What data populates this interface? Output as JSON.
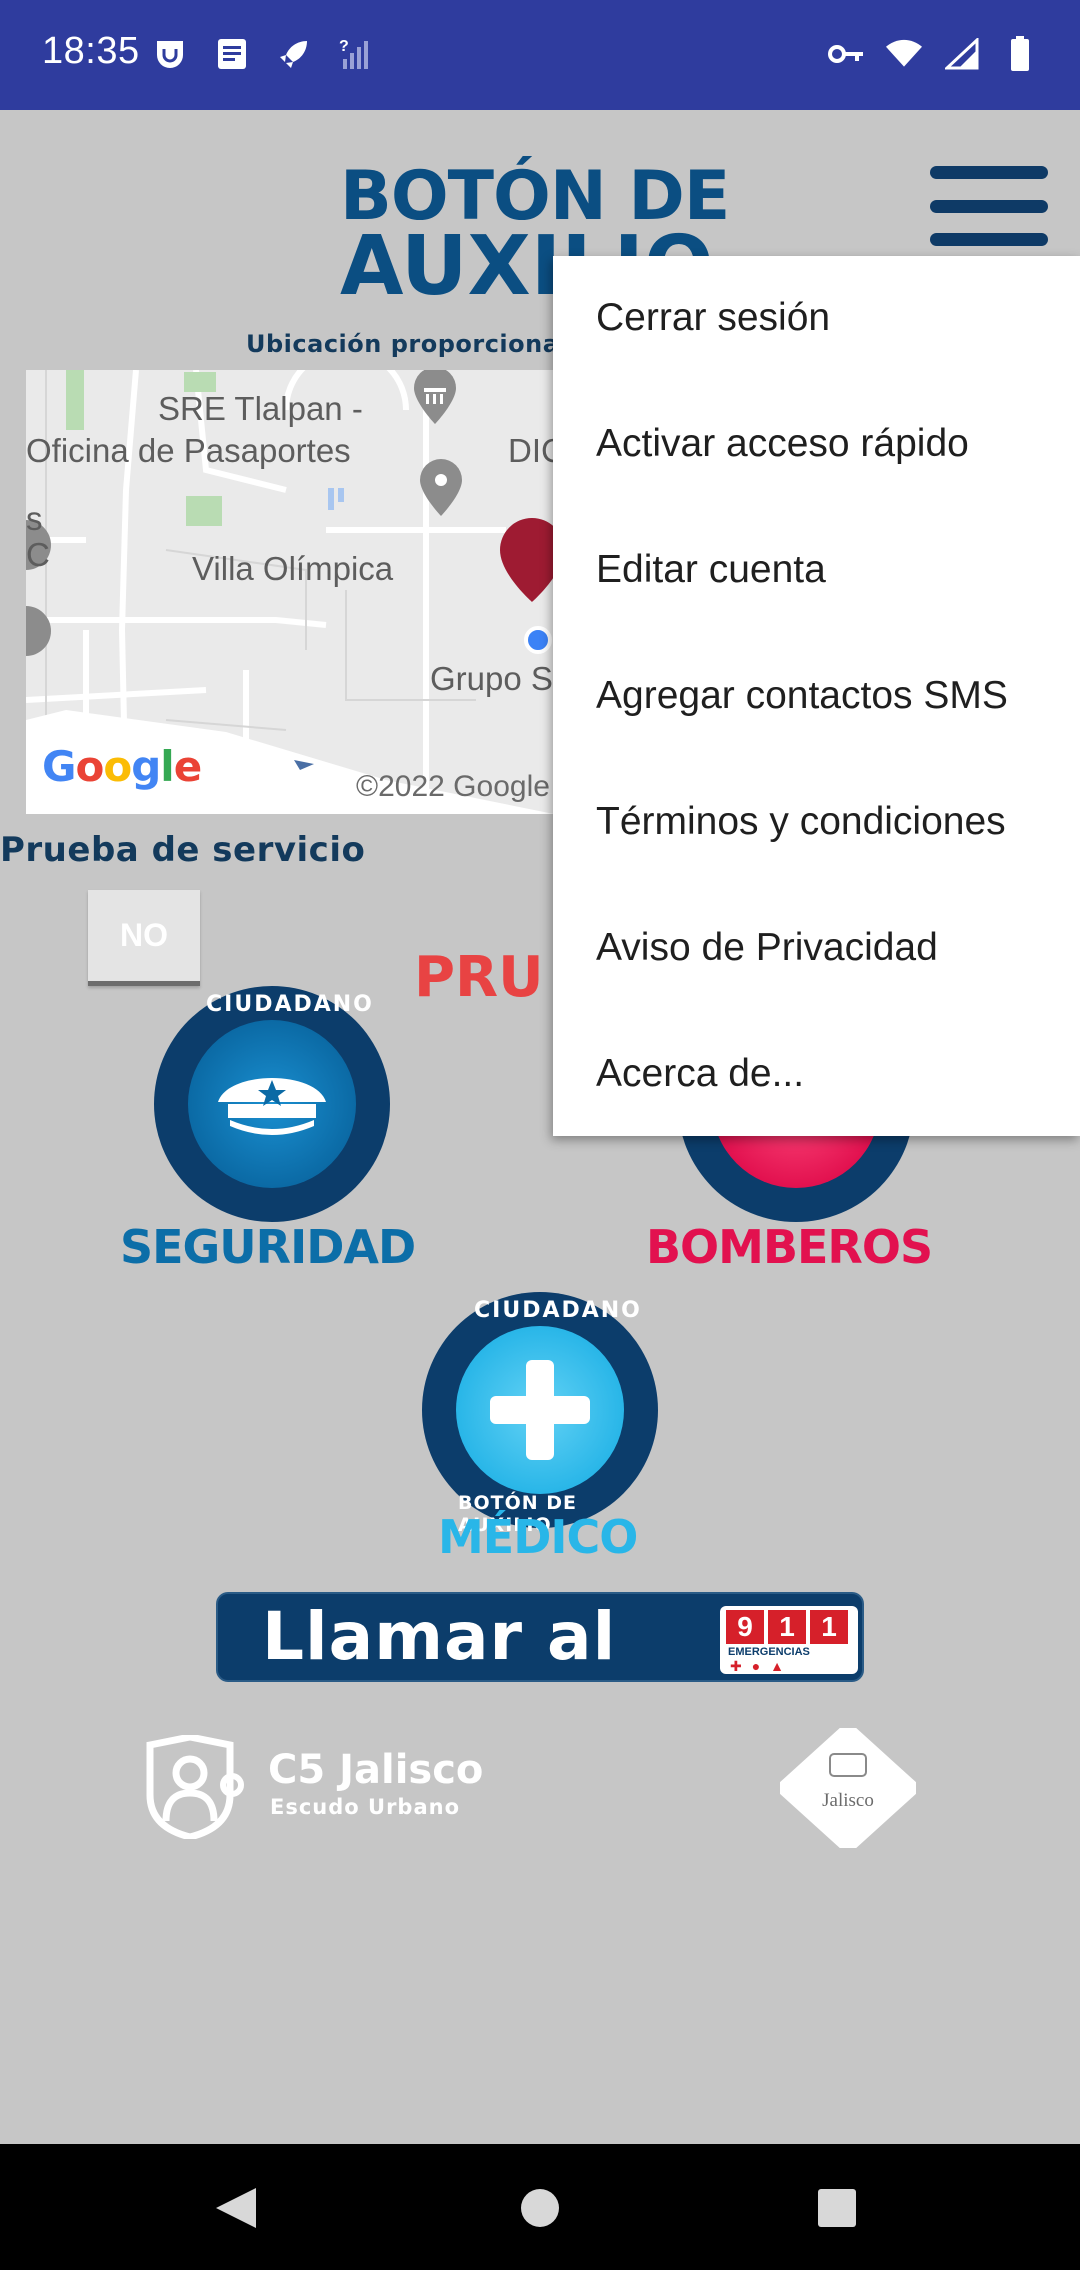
{
  "status_bar": {
    "time": "18:35",
    "left_icons": [
      "drive-icon",
      "document-icon",
      "rocket-icon",
      "signal-question-icon"
    ],
    "right_icons": [
      "vpn-key-icon",
      "wifi-icon",
      "cell-signal-icon",
      "battery-icon"
    ]
  },
  "header": {
    "logo_line1": "BOTÓN DE",
    "logo_line2": "AUXILIO",
    "menu_icon": "hamburger-menu-icon"
  },
  "location": {
    "caption": "Ubicación proporciona"
  },
  "map": {
    "labels": [
      "SRE Tlalpan -",
      "Oficina de Pasaportes",
      "DIC",
      "Villa Olímpica",
      "Grupo S",
      "s",
      "C"
    ],
    "google_logo": "Google",
    "copyright": "©2022 Google"
  },
  "test_service": {
    "label": "Prueba de servicio",
    "toggle_value": "NO",
    "banner": "PRU"
  },
  "badges": {
    "ring_text_top": "CIUDADANO",
    "ring_text_bottom": "BOTÓN DE AUXILIO",
    "security_label": "SEGURIDAD",
    "firefighters_label": "BOMBEROS",
    "medical_label": "MÉDICO"
  },
  "call": {
    "label": "Llamar al",
    "emergency_number": [
      "9",
      "1",
      "1"
    ],
    "emergency_sub": "EMERGENCIAS"
  },
  "footer_logos": {
    "c5_title": "C5 Jalisco",
    "c5_subtitle": "Escudo Urbano",
    "jalisco": "Jalisco"
  },
  "overflow_menu": {
    "items": [
      "Cerrar sesión",
      "Activar acceso rápido",
      "Editar cuenta",
      "Agregar contactos SMS",
      "Términos y condiciones",
      "Aviso de Privacidad",
      "Acerca de..."
    ]
  },
  "colors": {
    "status_bar": "#2f3c9e",
    "brand_blue": "#0b4e82",
    "security_blue": "#0c6ea8",
    "firefighter_red": "#e2114f",
    "medical_cyan": "#29b6e8",
    "background": "#c6c6c6"
  }
}
